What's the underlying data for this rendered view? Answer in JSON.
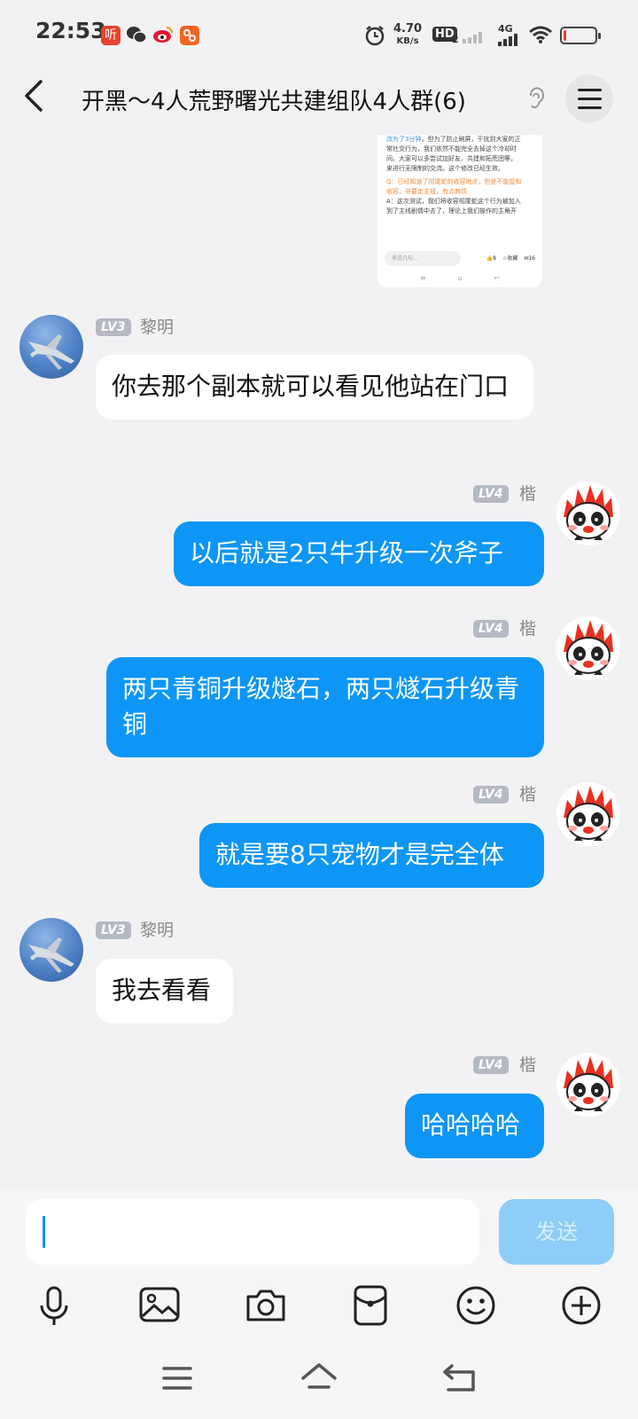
{
  "status_bar": {
    "time": "22:53",
    "notification_icons": [
      "ting-app-icon",
      "wechat-icon",
      "weibo-icon",
      "shared-app-icon"
    ],
    "net_speed_value": "4.70",
    "net_speed_unit": "KB/s",
    "hd_badge": "HD",
    "hd_sub": "2",
    "network": "4G",
    "battery_level": 0.1,
    "battery_color": "#e0403c"
  },
  "header": {
    "title": "开黑～4人荒野曙光共建组队4人群(6)"
  },
  "shared_image": {
    "lines": [
      {
        "text": "改为了3分钟，但为了防止刷屏，干扰到大家的正",
        "color": "mixed"
      },
      {
        "text": "常社交行为，我们依然不能完全去掉这个冷却时",
        "color": "normal"
      },
      {
        "text": "间。大家可以多尝试加好友、共建和拓荒团等，",
        "color": "normal"
      },
      {
        "text": "来进行无限制的交流。这个修改已经生效。",
        "color": "normal"
      },
      {
        "text": "Q：已经知道了彻尾蛇的收容地点，但是不能捉和",
        "color": "orange"
      },
      {
        "text": "收容，非要走主线，有点麻烦",
        "color": "orange"
      },
      {
        "text": "A：这次测试，我们将收容彻尾蛇这个行为被加入",
        "color": "normal"
      },
      {
        "text": "到了主线剧情中去了，理论上我们操作的主角开",
        "color": "normal"
      }
    ],
    "input_placeholder": "来说几句...",
    "likes": "8",
    "favorite_label": "收藏",
    "comments": "16"
  },
  "messages": [
    {
      "side": "in",
      "level": "LV3",
      "name": "黎明",
      "text": "你去那个副本就可以看见他站在门口",
      "avatar": "jet-avatar"
    },
    {
      "side": "out",
      "level": "LV4",
      "name": "楷",
      "text": "以后就是2只牛升级一次斧子",
      "avatar": "angry-panda-avatar"
    },
    {
      "side": "out",
      "level": "LV4",
      "name": "楷",
      "text": "两只青铜升级燧石，两只燧石升级青铜",
      "avatar": "angry-panda-avatar"
    },
    {
      "side": "out",
      "level": "LV4",
      "name": "楷",
      "text": "就是要8只宠物才是完全体",
      "avatar": "angry-panda-avatar"
    },
    {
      "side": "in",
      "level": "LV3",
      "name": "黎明",
      "text": "我去看看",
      "avatar": "jet-avatar"
    },
    {
      "side": "out",
      "level": "LV4",
      "name": "楷",
      "text": "哈哈哈哈",
      "avatar": "angry-panda-avatar"
    }
  ],
  "composer": {
    "input_value": "",
    "send_label": "发送"
  },
  "toolbar": [
    "microphone-icon",
    "image-icon",
    "camera-icon",
    "red-packet-icon",
    "emoji-icon",
    "plus-icon"
  ],
  "colors": {
    "accent": "#0d96f6",
    "send_disabled": "#8ecdf8",
    "level_badge": "#b4b9c4",
    "background": "#f2f2f4"
  }
}
